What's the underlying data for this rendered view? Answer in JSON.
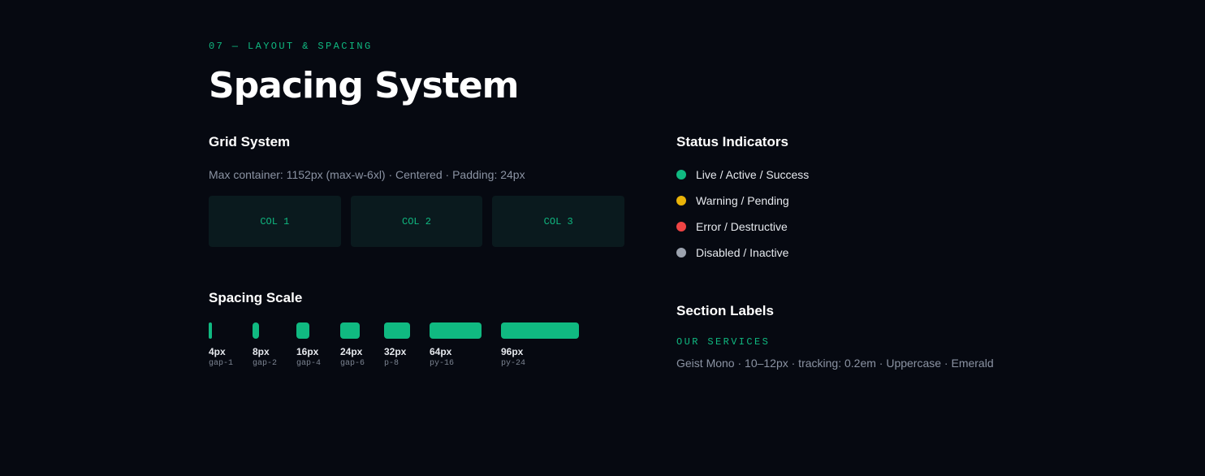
{
  "section": {
    "eyebrow": "07 — LAYOUT & SPACING",
    "title": "Spacing System"
  },
  "grid": {
    "heading": "Grid System",
    "description": "Max container: 1152px (max-w-6xl) · Centered · Padding: 24px",
    "columns": [
      "COL 1",
      "COL 2",
      "COL 3"
    ]
  },
  "spacing": {
    "heading": "Spacing Scale",
    "items": [
      {
        "value": "4px",
        "token": "gap-1"
      },
      {
        "value": "8px",
        "token": "gap-2"
      },
      {
        "value": "16px",
        "token": "gap-4"
      },
      {
        "value": "24px",
        "token": "gap-6"
      },
      {
        "value": "32px",
        "token": "p-8"
      },
      {
        "value": "64px",
        "token": "py-16"
      },
      {
        "value": "96px",
        "token": "py-24"
      }
    ]
  },
  "status": {
    "heading": "Status Indicators",
    "items": [
      {
        "label": "Live / Active / Success",
        "color": "#10b981"
      },
      {
        "label": "Warning / Pending",
        "color": "#eab308"
      },
      {
        "label": "Error / Destructive",
        "color": "#ef4444"
      },
      {
        "label": "Disabled / Inactive",
        "color": "#9ca3af"
      }
    ]
  },
  "labels": {
    "heading": "Section Labels",
    "example": "OUR SERVICES",
    "description": "Geist Mono · 10–12px · tracking: 0.2em · Uppercase · Emerald"
  },
  "colors": {
    "background": "#060911",
    "accent": "#10b981",
    "card": "#0a1a1e"
  }
}
